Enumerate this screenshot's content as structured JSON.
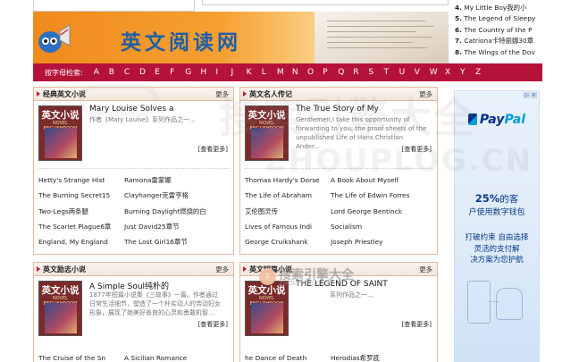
{
  "banner": {
    "title": "英文阅读网"
  },
  "top_list": [
    {
      "num": "4.",
      "text": "My Little Boy我的小"
    },
    {
      "num": "5.",
      "text": "The Legend of Sleepy"
    },
    {
      "num": "6.",
      "text": "The Country of the P"
    },
    {
      "num": "7.",
      "text": "Catriona卡特丽娜30章"
    },
    {
      "num": "8.",
      "text": "The Wings of the Dov"
    }
  ],
  "alpha": {
    "label": "按字母检索:",
    "letters": [
      "A",
      "B",
      "C",
      "D",
      "E",
      "F",
      "G",
      "H",
      "I",
      "J",
      "K",
      "L",
      "M",
      "N",
      "O",
      "P",
      "Q",
      "R",
      "S",
      "T",
      "U",
      "V",
      "W",
      "X",
      "Y",
      "Z"
    ]
  },
  "panels": {
    "classic": {
      "title": "经典英文小说",
      "more": "更多",
      "feat_title": "Mary Louise Solves a",
      "feat_desc": "作者《Mary Louise》系列作品之一...",
      "feat_more": "[查看更多]",
      "links": [
        "Hetty's Strange Hist",
        "Ramona雷蒙娜",
        "The Burning Secret15",
        "Clayhanger克雷亨格",
        "Two-Legs两条腿",
        "Burning Daylight燃烧的白",
        "The Scarlet Plague6章",
        "Just David25章节",
        "England, My England",
        "The Lost Girl16章节"
      ]
    },
    "bio": {
      "title": "英文名人传记",
      "more": "更多",
      "feat_title": "The True Story of My",
      "feat_desc": "Gentlemen,I take this opportunity of forwarding to you, the proof sheets of the unpublished Life of Hans Christian Ander...",
      "feat_more": "[查看更多]",
      "links": [
        "Thomas Hardy's Dorse",
        "A Book About Myself",
        "The Life of Abraham",
        "The Life of Edwin Forres",
        "艾伦图灵传",
        "Lord George Bentinck",
        "Lives of Famous Indi",
        "Socialism",
        "George Cruikshank",
        "Joseph Priestley"
      ]
    },
    "inspire": {
      "title": "英文励志小说",
      "more": "更多",
      "feat_title": "A Simple Soul纯朴的",
      "feat_desc": "1877年短篇小说集《三故事》一篇。作者通过日常生活细节，塑造了一个朴实动人的劳动妇女形象，展现了她美好善良的心灵和勇敢机智...",
      "feat_more": "[查看更多]",
      "links": [
        "The Cruise of the Sn",
        "A Sicilian Romance"
      ]
    },
    "short": {
      "title": "英文短篇小说",
      "more": "更多",
      "feat_title": "THE LEGEND OF SAINT",
      "feat_desc": "系列作品之一...",
      "feat_more": "[查看更多]",
      "links": [
        "he Dance of Death",
        "Herodias希罗底"
      ]
    }
  },
  "cover": {
    "title": "英文小说",
    "subtitle": "NOVEL ENGLISHROOM"
  },
  "ad": {
    "close": [
      "▷",
      "✕"
    ],
    "brand_pay": "Pay",
    "brand_pal": "Pal",
    "line1_pct": "25%",
    "line1_rest": "的客",
    "line2": "户使用数字钱包",
    "line3a": "打破约束 自由选择",
    "line3b": "灵活的支付解",
    "line3c": "决方案为您护航"
  },
  "watermark": {
    "big": "搜索引擎大全",
    "url": "ZHOUPLOG.CN",
    "small_logo": "Z",
    "small_text": "搜索引擎大全",
    "small_url": "ZHOUPLOG.CN"
  },
  "colors": {
    "alpha_bar": "#b5123a",
    "banner_orange": "#f08a1c",
    "title_blue": "#1f5fa8",
    "panel_border": "#e3b9a0",
    "paypal_blue": "#003087"
  }
}
